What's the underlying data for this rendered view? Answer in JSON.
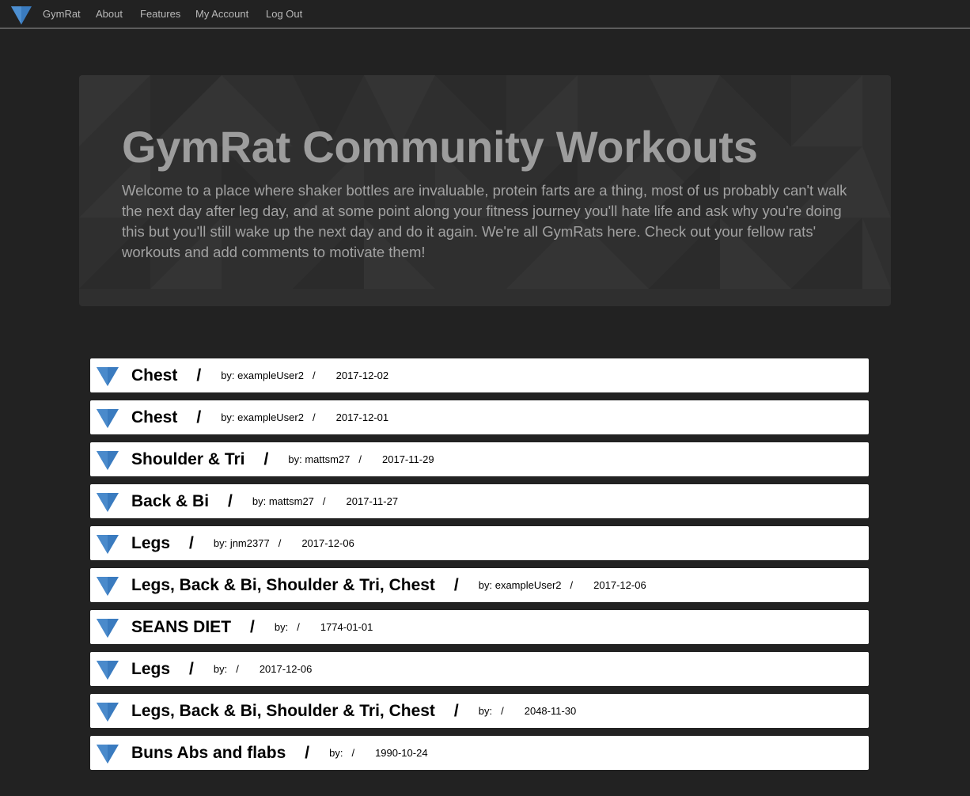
{
  "nav": {
    "brand": "GymRat",
    "links": [
      "About",
      "Features",
      "My Account",
      "Log Out"
    ]
  },
  "jumbotron": {
    "title": "GymRat Community Workouts",
    "text": "Welcome to a place where shaker bottles are invaluable, protein farts are a thing, most of us probably can't walk the next day after leg day, and at some point along your fitness journey you'll hate life and ask why you're doing this but you'll still wake up the next day and do it again. We're all GymRats here. Check out your fellow rats' workouts and add comments to motivate them!"
  },
  "workouts": [
    {
      "title": "Chest",
      "by": "by: exampleUser2",
      "date": "2017-12-02"
    },
    {
      "title": "Chest",
      "by": "by: exampleUser2",
      "date": "2017-12-01"
    },
    {
      "title": "Shoulder & Tri",
      "by": "by: mattsm27",
      "date": "2017-11-29"
    },
    {
      "title": "Back & Bi",
      "by": "by: mattsm27",
      "date": "2017-11-27"
    },
    {
      "title": "Legs",
      "by": "by: jnm2377",
      "date": "2017-12-06"
    },
    {
      "title": "Legs, Back & Bi, Shoulder & Tri, Chest",
      "by": "by: exampleUser2",
      "date": "2017-12-06"
    },
    {
      "title": "SEANS DIET",
      "by": "by:",
      "date": "1774-01-01"
    },
    {
      "title": "Legs",
      "by": "by:",
      "date": "2017-12-06"
    },
    {
      "title": "Legs, Back & Bi, Shoulder & Tri, Chest",
      "by": "by:",
      "date": "2048-11-30"
    },
    {
      "title": "Buns Abs and flabs",
      "by": "by:",
      "date": "1990-10-24"
    }
  ],
  "separator": "/",
  "colors": {
    "background": "#222222",
    "jumbotron": "#2f2f2f",
    "accent_blue": "#3a7bbf",
    "row_background": "#ffffff"
  },
  "icons": {
    "logo": "blue-diamond-icon",
    "row": "blue-diamond-icon"
  }
}
